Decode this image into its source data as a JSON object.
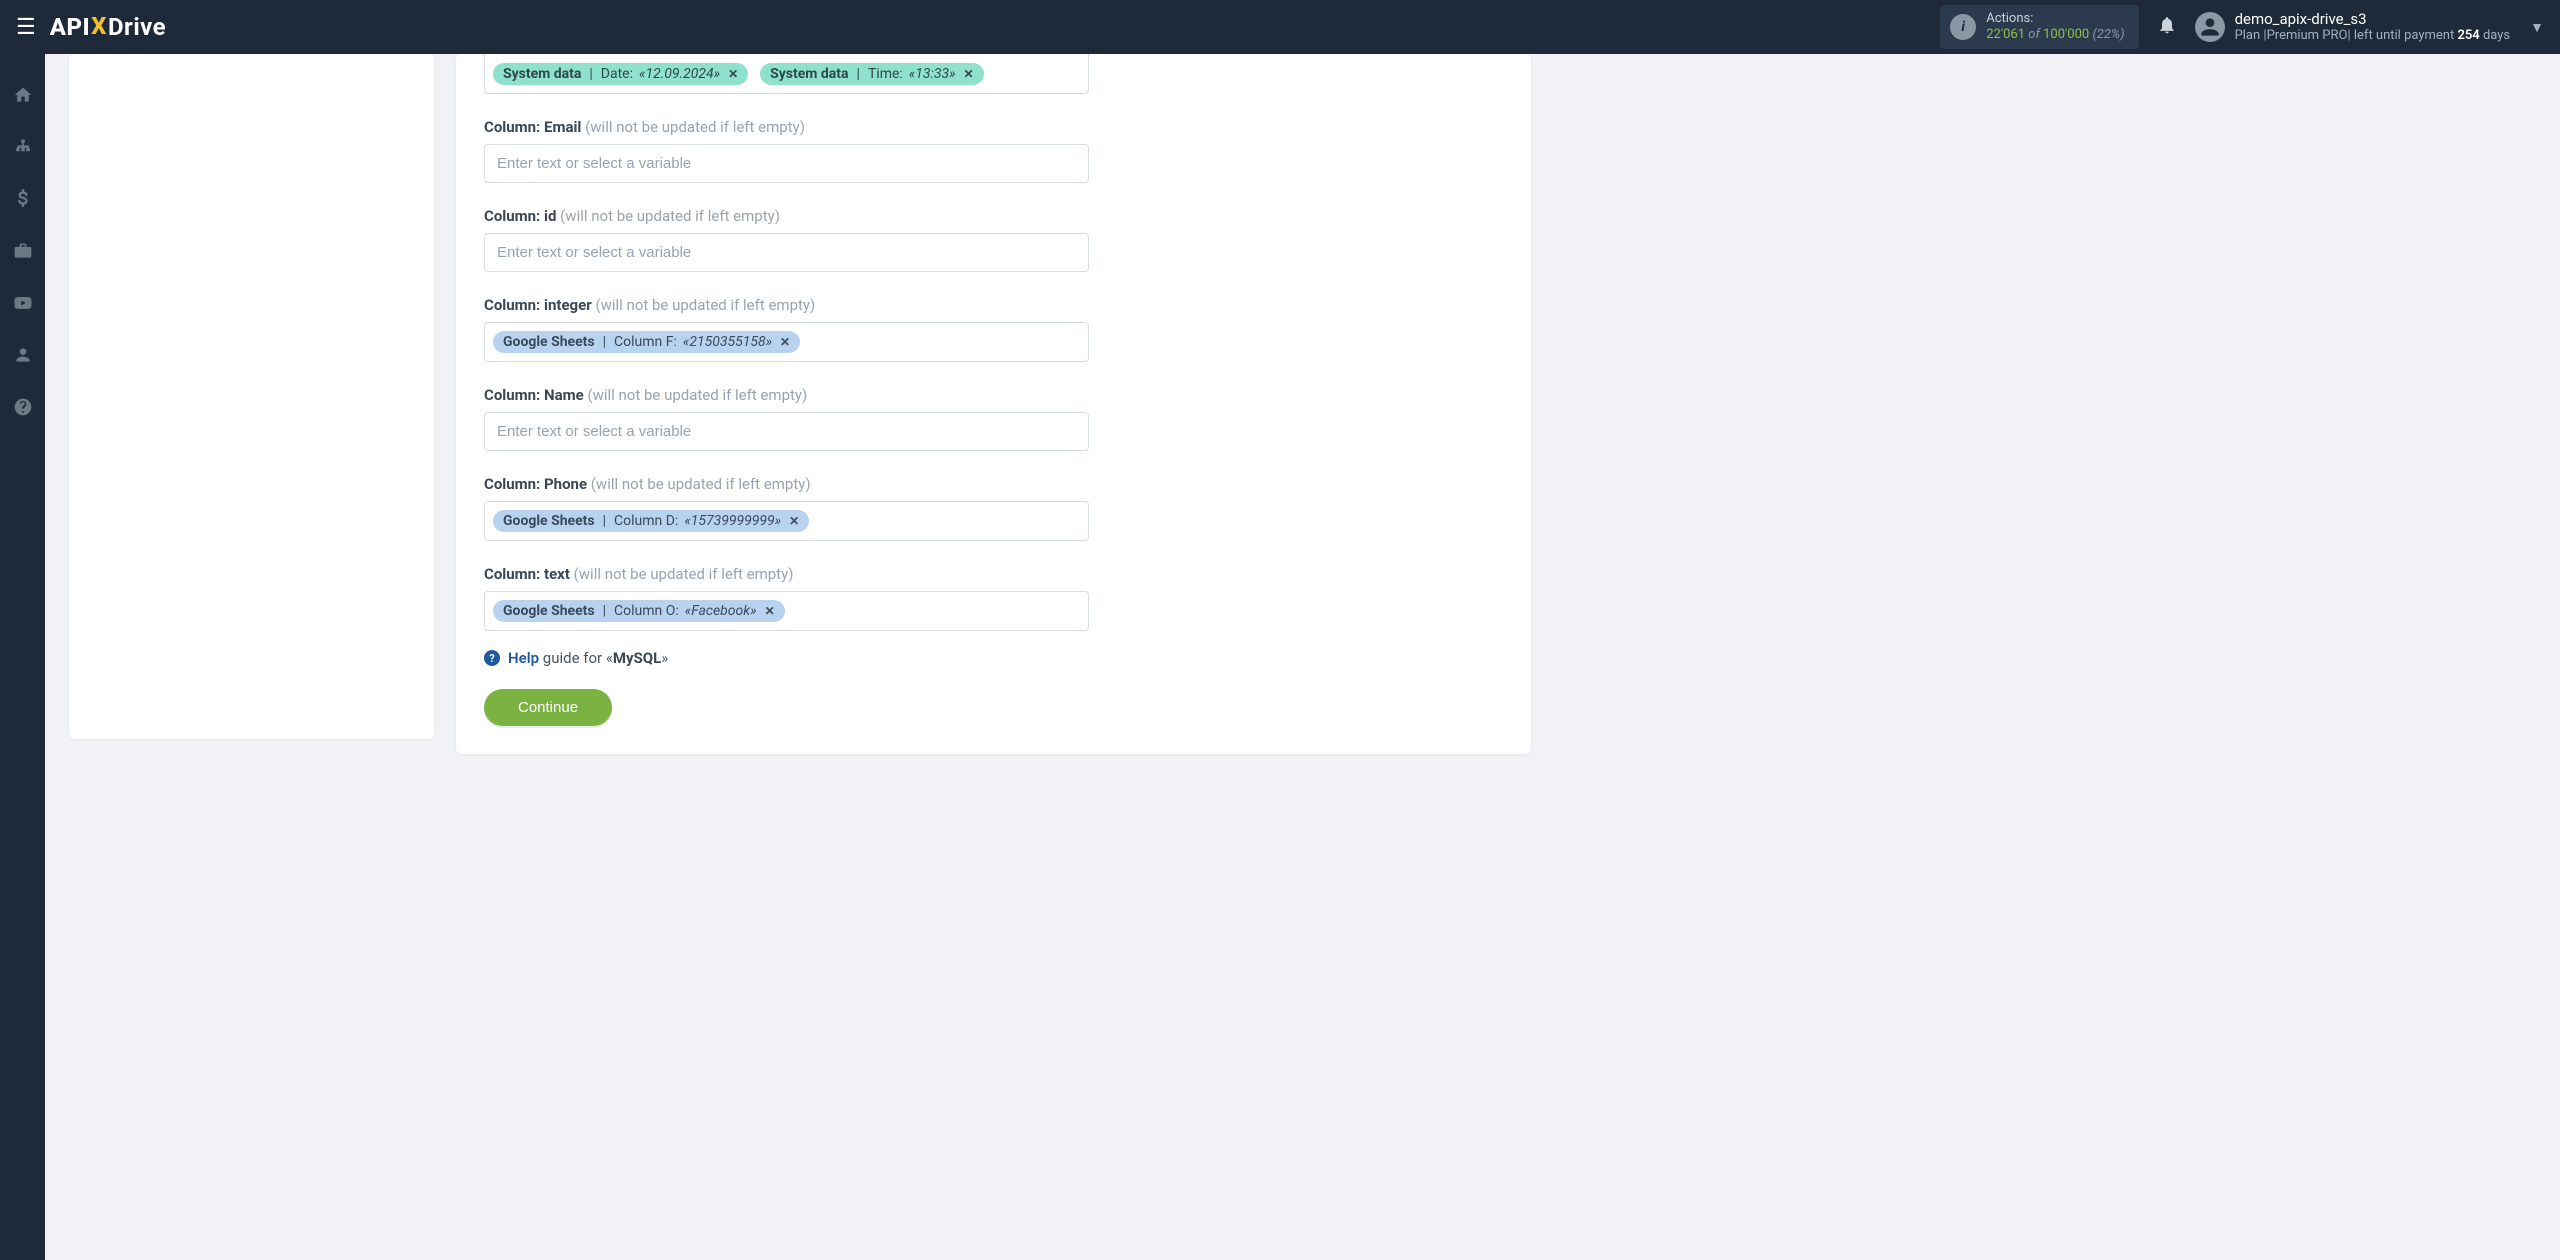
{
  "header": {
    "logo_part1": "API",
    "logo_x": "X",
    "logo_part2": "Drive",
    "actions_label": "Actions:",
    "actions_used": "22'061",
    "actions_of": "of",
    "actions_total": "100'000",
    "actions_pct": "(22%)",
    "user_name": "demo_apix-drive_s3",
    "plan_prefix": "Plan |",
    "plan_name": "Premium PRO",
    "plan_mid": "| left until payment ",
    "plan_days": "254",
    "plan_suffix": " days"
  },
  "form": {
    "top_tags": [
      {
        "src": "System data",
        "label": "Date:",
        "val": "«12.09.2024»"
      },
      {
        "src": "System data",
        "label": "Time:",
        "val": "«13:33»"
      }
    ],
    "placeholder": "Enter text or select a variable",
    "hint": "(will not be updated if left empty)",
    "fields": {
      "email": {
        "label": "Column: Email"
      },
      "id": {
        "label": "Column: id"
      },
      "integer": {
        "label": "Column: integer",
        "tag": {
          "src": "Google Sheets",
          "label": "Column F:",
          "val": "«2150355158»"
        }
      },
      "name": {
        "label": "Column: Name"
      },
      "phone": {
        "label": "Column: Phone",
        "tag": {
          "src": "Google Sheets",
          "label": "Column D:",
          "val": "«15739999999»"
        }
      },
      "text": {
        "label": "Column: text",
        "tag": {
          "src": "Google Sheets",
          "label": "Column O:",
          "val": "«Facebook»"
        }
      }
    },
    "help_word": "Help",
    "help_text": "guide for «",
    "help_target": "MySQL",
    "help_suffix": "»",
    "continue": "Continue"
  }
}
